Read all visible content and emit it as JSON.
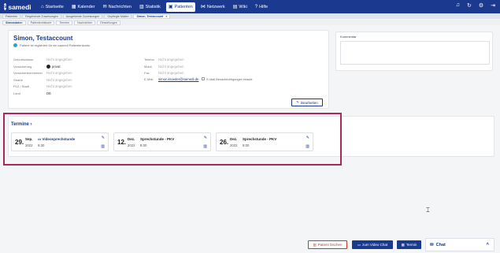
{
  "app": {
    "logo": "samedi",
    "logo_glyph": "s"
  },
  "nav": [
    {
      "label": "Startseite",
      "icon": "home-icon",
      "glyph": "⌂"
    },
    {
      "label": "Kalender",
      "icon": "calendar-icon",
      "glyph": "▦"
    },
    {
      "label": "Nachrichten",
      "icon": "mail-icon",
      "glyph": "✉"
    },
    {
      "label": "Statistik",
      "icon": "chart-icon",
      "glyph": "▥"
    },
    {
      "label": "Patienten",
      "icon": "patients-icon",
      "glyph": "▣",
      "active": true
    },
    {
      "label": "Netzwerk",
      "icon": "network-icon",
      "glyph": "⋈"
    },
    {
      "label": "Wiki",
      "icon": "book-icon",
      "glyph": "▤"
    },
    {
      "label": "Hilfe",
      "icon": "help-icon",
      "glyph": "?"
    }
  ],
  "top_icons": [
    {
      "name": "bell-icon",
      "glyph": "♫"
    },
    {
      "name": "refresh-icon",
      "glyph": "↻"
    },
    {
      "name": "user-settings-icon",
      "glyph": "⚙"
    },
    {
      "name": "logout-icon",
      "glyph": "⇥"
    }
  ],
  "tabs": [
    "Patienten",
    "Eingehende Zuweisungen",
    "Ausgehende Zuweisungen",
    "Gepflegte Mailen",
    "Simon, Testaccount"
  ],
  "tab_close": "×",
  "subtabs": [
    "Stammdaten",
    "Patientenhistorie",
    "Termine",
    "Nachrichten",
    "Einstellungen"
  ],
  "patient": {
    "name": "Simon, Testaccount",
    "verified_text": "Patient ist registriert für ein samedi Patientenkonto"
  },
  "fields_left": [
    {
      "label": "Geburtsdatum",
      "value": "Nicht angegeben",
      "muted": true
    },
    {
      "label": "Versicherung",
      "value": "privat",
      "muted": false,
      "badge": "P"
    },
    {
      "label": "Versichertennummer",
      "value": "Nicht angegeben",
      "muted": true
    },
    {
      "label": "Straße",
      "value": "Nicht angegeben",
      "muted": true
    },
    {
      "label": "PLZ / Stadt",
      "value": "Nicht angegeben",
      "muted": true
    },
    {
      "label": "Land",
      "value": "DE",
      "muted": false
    }
  ],
  "fields_right": [
    {
      "label": "Telefon",
      "value": "Nicht angegeben"
    },
    {
      "label": "Mobil",
      "value": "Nicht angegeben"
    },
    {
      "label": "Fax",
      "value": "Nicht angegeben"
    }
  ],
  "email": {
    "label": "E-Mail",
    "value": "simon.kroeder@samedi.de",
    "checkbox_label": "E-Mail Benachrichtigungen erlaubt"
  },
  "edit_button": "Bearbeiten",
  "kommentar_title": "Kommentar",
  "termine": {
    "title": "Termine",
    "appointments": [
      {
        "day": "29.",
        "month": "Sep.",
        "year": "2022",
        "title": "Videosprechstunde",
        "time": "9:30",
        "video": true
      },
      {
        "day": "12.",
        "month": "Dez.",
        "year": "2022",
        "title": "Sprechstunde - PKV",
        "time": "8:00",
        "video": false
      },
      {
        "day": "26.",
        "month": "Dez.",
        "year": "2022",
        "title": "Sprechstunde - PKV",
        "time": "8:00",
        "video": false
      }
    ]
  },
  "actions": {
    "delete": "Patient löschen",
    "video_chat": "zum Video Chat",
    "termin": "Termin"
  },
  "chat": {
    "label": "Chat",
    "chevron": "^"
  },
  "colors": {
    "brand": "#1b3a8f",
    "highlight": "#b0265a",
    "danger": "#c0392b",
    "verified": "#2aa6c9"
  }
}
